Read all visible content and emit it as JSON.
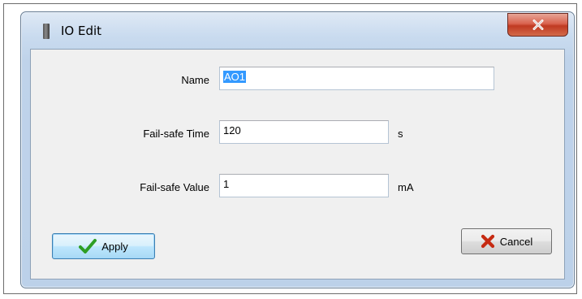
{
  "window": {
    "title": "IO Edit",
    "close_icon": "close-x-icon"
  },
  "form": {
    "name": {
      "label": "Name",
      "value": "AO1"
    },
    "failsafe_time": {
      "label": "Fail-safe Time",
      "value": "120",
      "unit": "s"
    },
    "failsafe_value": {
      "label": "Fail-safe Value",
      "value": "1",
      "unit": "mA"
    }
  },
  "buttons": {
    "apply": {
      "label": "Apply",
      "icon": "checkmark-icon",
      "icon_color": "#2e9e24"
    },
    "cancel": {
      "label": "Cancel",
      "icon": "x-mark-icon",
      "icon_color": "#c62a12"
    }
  },
  "colors": {
    "title_bar": "#c9dbef",
    "close_button": "#c9472f",
    "selection": "#3399ff"
  }
}
